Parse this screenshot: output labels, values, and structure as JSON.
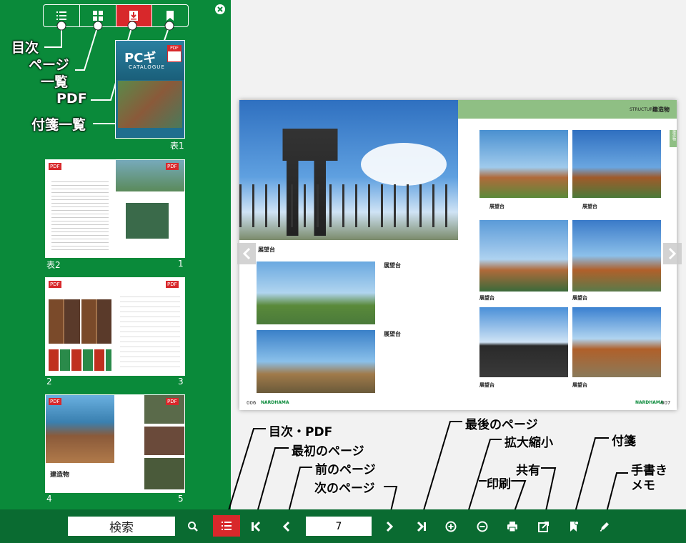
{
  "sidebar": {
    "buttons": [
      {
        "name": "toc-list-icon"
      },
      {
        "name": "grid-icon"
      },
      {
        "name": "pdf-download-icon"
      },
      {
        "name": "bookmark-icon"
      }
    ],
    "annotations": {
      "toc": "目次",
      "page_list_1": "ページ",
      "page_list_2": "一覧",
      "pdf": "PDF",
      "bookmark_list": "付箋一覧"
    },
    "cover": {
      "badge": "PDF",
      "brand": "PCギ",
      "brand_sub": "CATALOGUE",
      "label": "表1"
    },
    "thumbnails": [
      {
        "left_label": "表2",
        "right_label": "1",
        "pdf": "PDF"
      },
      {
        "left_label": "2",
        "right_label": "3",
        "pdf": "PDF"
      },
      {
        "left_label": "4",
        "right_label": "5",
        "pdf": "PDF",
        "heading": "建造物"
      }
    ]
  },
  "viewer": {
    "right_header_en": "STRUCTURE",
    "right_header_jp": "建造物",
    "side_tab": "建造物",
    "caption_label": "展望台",
    "left_page_no": "006",
    "right_page_no": "007",
    "brand_footer": "NARDHAMA"
  },
  "toolbar": {
    "search_label": "検索",
    "page_value": "7",
    "annotations": {
      "toc_pdf": "目次・PDF",
      "first_page": "最初のページ",
      "prev_page": "前のページ",
      "next_page": "次のページ",
      "last_page": "最後のページ",
      "zoom": "拡大縮小",
      "print": "印刷",
      "share": "共有",
      "bookmark": "付箋",
      "handwrite_1": "手書き",
      "handwrite_2": "メモ"
    }
  },
  "colors": {
    "sidebar_bg": "#0a8a3a",
    "toolbar_bg": "#0a6b31",
    "accent_red": "#d8282b",
    "header_green": "#8fbf84"
  }
}
